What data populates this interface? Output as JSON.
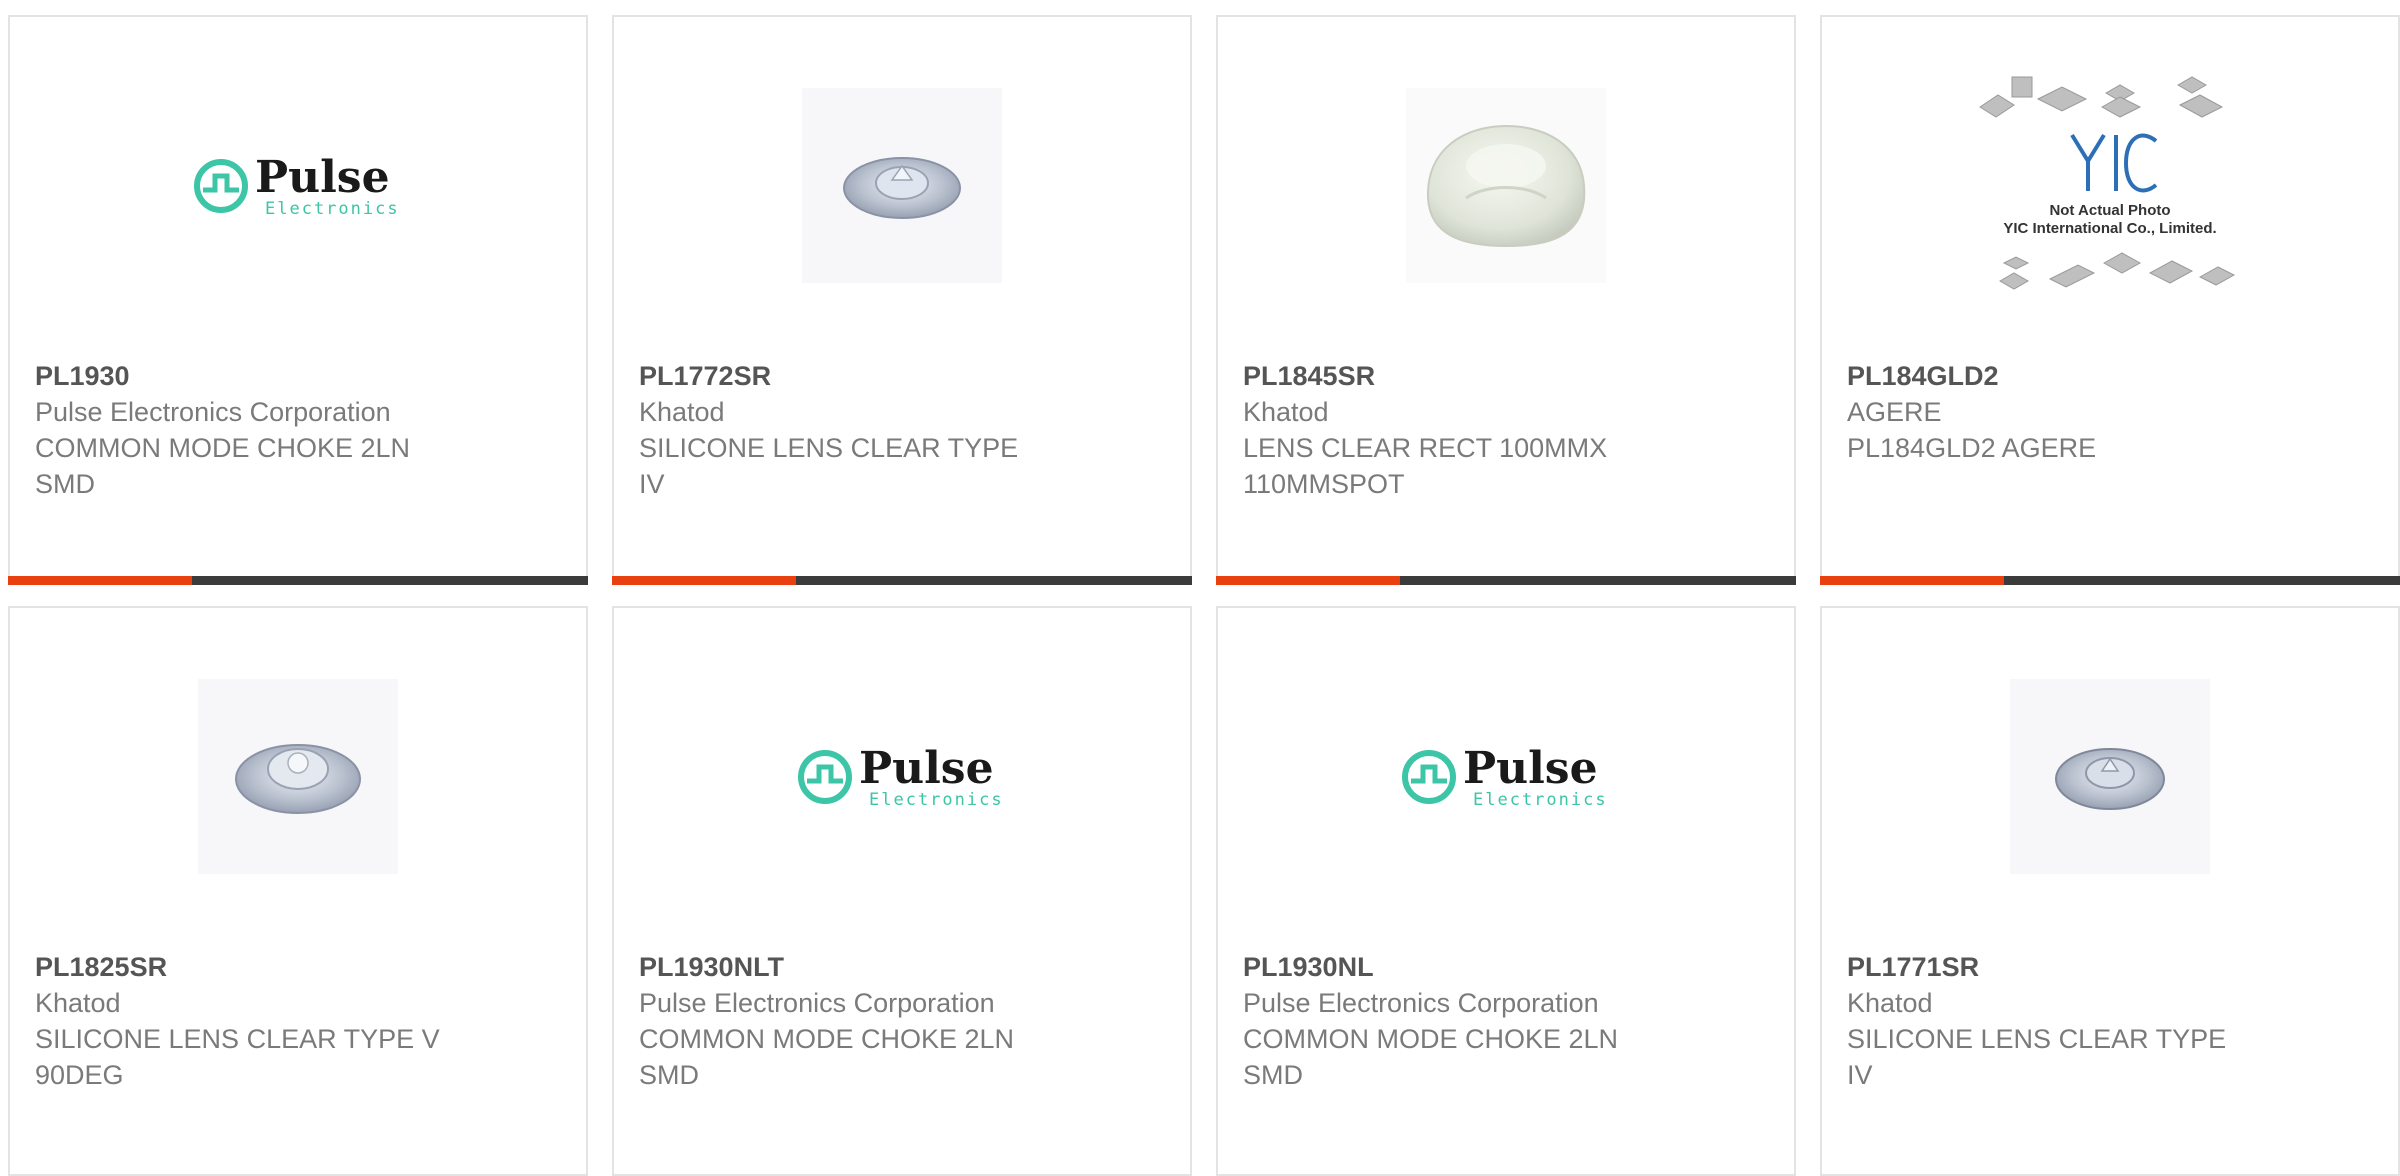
{
  "colors": {
    "accent_red": "#e8410f",
    "accent_dark": "#3b3b3b",
    "border": "#e3e3e3",
    "pulse_teal": "#3cc5a6"
  },
  "logos": {
    "pulse_word": "Pulse",
    "pulse_sub": "Electronics",
    "yic_mark": "YIC",
    "yic_line1": "Not Actual Photo",
    "yic_line2": "YIC International Co., Limited."
  },
  "products": [
    {
      "part": "PL1930",
      "manufacturer": "Pulse Electronics Corporation",
      "description": "COMMON MODE CHOKE 2LN\nSMD",
      "image": "pulse-logo"
    },
    {
      "part": "PL1772SR",
      "manufacturer": "Khatod",
      "description": "SILICONE LENS CLEAR TYPE\nIV",
      "image": "silicone-lens-flat"
    },
    {
      "part": "PL1845SR",
      "manufacturer": "Khatod",
      "description": "LENS CLEAR RECT 100MMX\n110MMSPOT",
      "image": "rect-lens-dome"
    },
    {
      "part": "PL184GLD2",
      "manufacturer": "AGERE",
      "description": "PL184GLD2 AGERE",
      "image": "yic-placeholder"
    },
    {
      "part": "PL1825SR",
      "manufacturer": "Khatod",
      "description": "SILICONE LENS CLEAR TYPE V\n90DEG",
      "image": "silicone-lens-flat"
    },
    {
      "part": "PL1930NLT",
      "manufacturer": "Pulse Electronics Corporation",
      "description": "COMMON MODE CHOKE 2LN\nSMD",
      "image": "pulse-logo"
    },
    {
      "part": "PL1930NL",
      "manufacturer": "Pulse Electronics Corporation",
      "description": "COMMON MODE CHOKE 2LN\nSMD",
      "image": "pulse-logo"
    },
    {
      "part": "PL1771SR",
      "manufacturer": "Khatod",
      "description": "SILICONE LENS CLEAR TYPE\nIV",
      "image": "silicone-lens-flat"
    }
  ]
}
